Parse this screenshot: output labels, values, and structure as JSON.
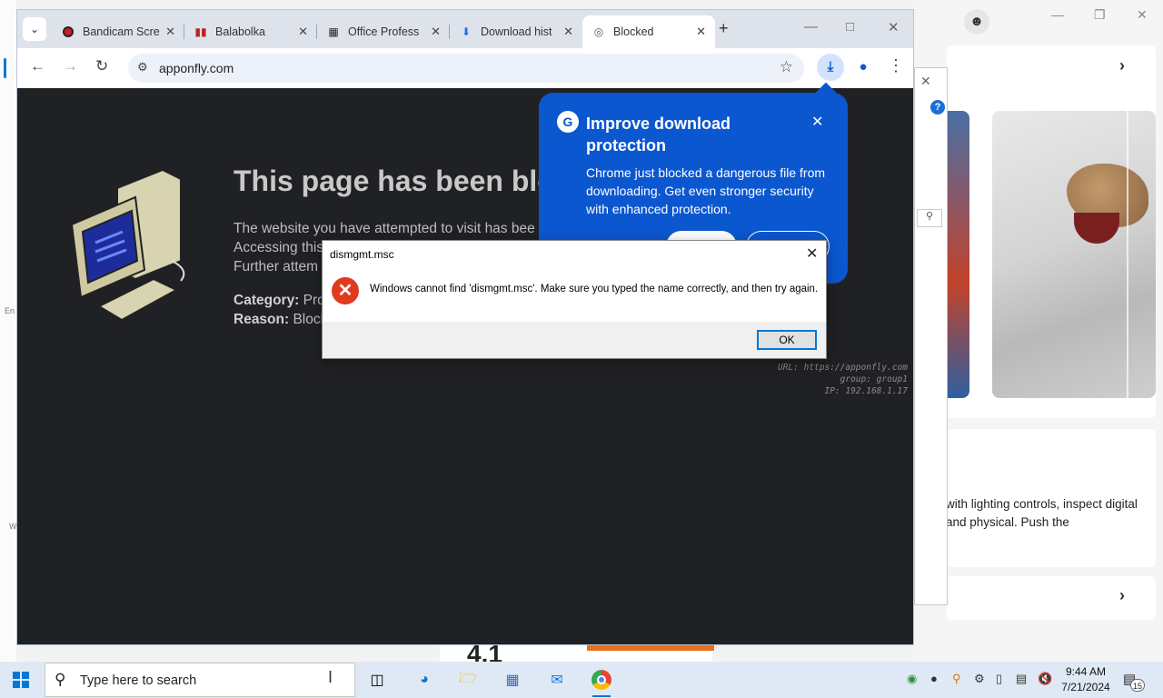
{
  "chrome": {
    "tabs": [
      {
        "label": "Bandicam Scre",
        "icon": "record-icon"
      },
      {
        "label": "Balabolka",
        "icon": "balabolka-icon"
      },
      {
        "label": "Office Profess",
        "icon": "office-icon"
      },
      {
        "label": "Download hist",
        "icon": "download-icon"
      },
      {
        "label": "Blocked",
        "icon": "globe-icon",
        "active": true
      }
    ],
    "url": "apponfly.com"
  },
  "blocked_page": {
    "heading": "This page has been blo",
    "line1": "The website you have attempted to visit has bee",
    "line2": "Accessing this",
    "line3": "Further attem",
    "category_label": "Category:",
    "category_value": "Pro",
    "reason_label": "Reason:",
    "reason_value": "Block",
    "url_meta": "URL: https://apponfly.com",
    "group_meta": "group: group1",
    "ip_meta": "IP: 192.168.1.17"
  },
  "bubble": {
    "title": "Improve download protection",
    "body": "Chrome just blocked a dangerous file from downloading. Get even stronger security with enhanced protection."
  },
  "dialog": {
    "title": "dismgmt.msc",
    "message": "Windows cannot find 'dismgmt.msc'. Make sure you typed the name correctly, and then try again.",
    "ok_label": "OK"
  },
  "background_app": {
    "description": "with lighting controls, inspect digital and physical. Push the",
    "big_text": "4.1"
  },
  "left_slivers": {
    "text1": "En",
    "text2": "W"
  },
  "taskbar": {
    "search_placeholder": "Type here to search",
    "time": "9:44 AM",
    "date": "7/21/2024",
    "notification_count": "15"
  },
  "colors": {
    "chrome_accent": "#0b57d0",
    "error_red": "#e0391e",
    "windows_blue": "#0078d4"
  }
}
